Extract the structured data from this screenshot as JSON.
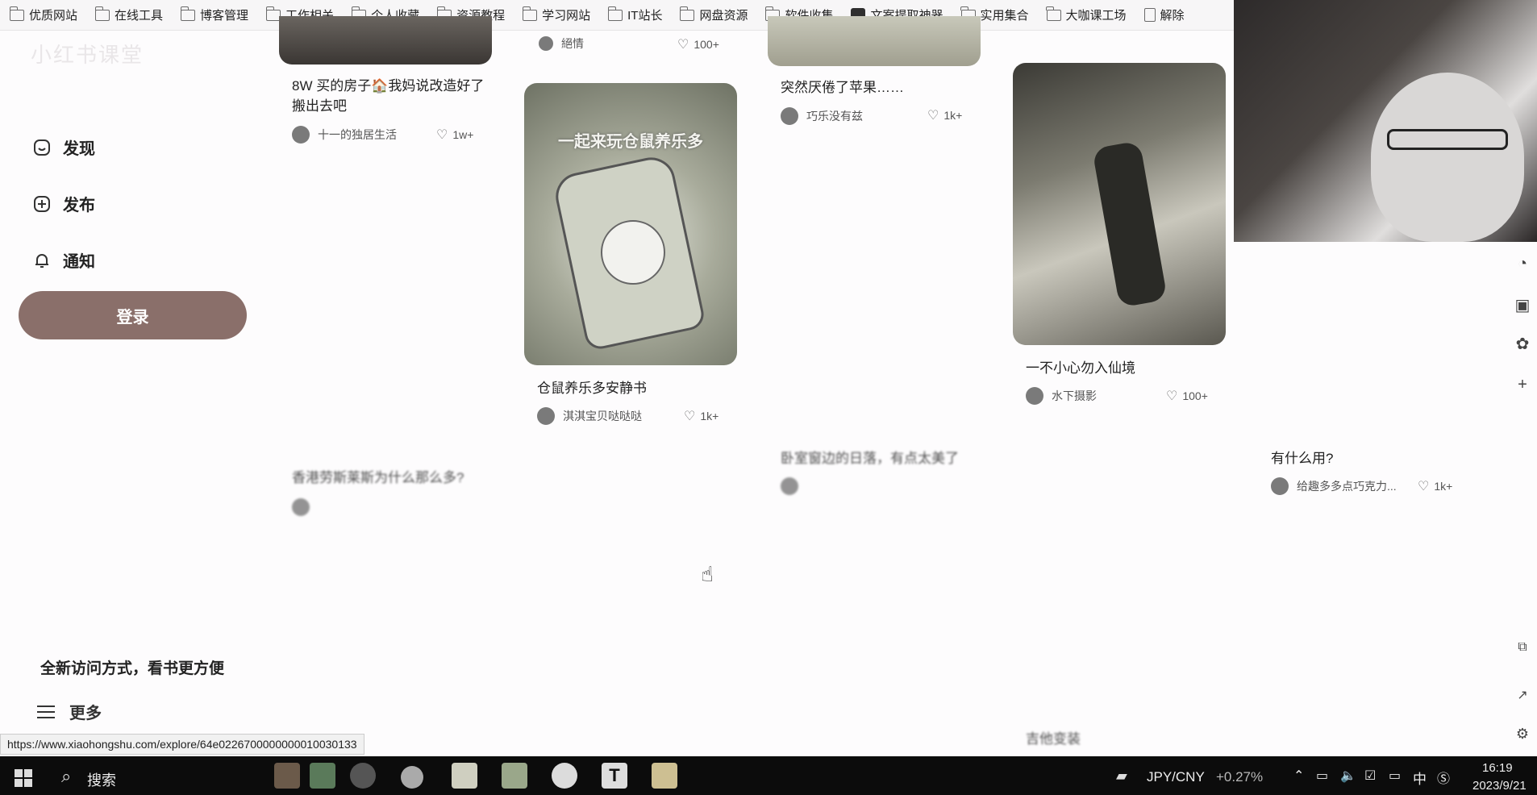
{
  "bookmarks": [
    {
      "label": "优质网站",
      "icon": "folder-icon"
    },
    {
      "label": "在线工具",
      "icon": "folder-icon"
    },
    {
      "label": "博客管理",
      "icon": "folder-icon"
    },
    {
      "label": "工作相关",
      "icon": "folder-icon"
    },
    {
      "label": "个人收藏",
      "icon": "folder-icon"
    },
    {
      "label": "资源教程",
      "icon": "folder-icon"
    },
    {
      "label": "学习网站",
      "icon": "folder-icon"
    },
    {
      "label": "IT站长",
      "icon": "folder-icon"
    },
    {
      "label": "网盘资源",
      "icon": "folder-icon"
    },
    {
      "label": "软件收集",
      "icon": "folder-icon"
    },
    {
      "label": "文案提取神器",
      "icon": "app-icon"
    },
    {
      "label": "实用集合",
      "icon": "folder-icon"
    },
    {
      "label": "大咖课工场",
      "icon": "folder-icon"
    },
    {
      "label": "解除",
      "icon": "doc-icon"
    }
  ],
  "sidebar": {
    "nav": [
      {
        "label": "发现",
        "icon": "home-icon"
      },
      {
        "label": "发布",
        "icon": "plus-circle-icon"
      },
      {
        "label": "通知",
        "icon": "bell-icon"
      }
    ],
    "login_label": "登录",
    "promo": "全新访问方式，看书更方便",
    "more_label": "更多"
  },
  "cards": [
    {
      "title": "8W 买的房子🏠我妈说改造好了搬出去吧",
      "author": "十一的独居生活",
      "likes": "1w+"
    },
    {
      "title": "",
      "author": "絕情",
      "likes": "100+"
    },
    {
      "title": "仓鼠养乐多安静书",
      "author": "淇淇宝贝哒哒哒",
      "likes": "1k+",
      "image_text": "一起来玩仓鼠养乐多"
    },
    {
      "title": "突然厌倦了苹果……",
      "author": "巧乐没有兹",
      "likes": "1k+"
    },
    {
      "title": "一不小心勿入仙境",
      "author": "水下摄影",
      "likes": "100+"
    },
    {
      "title": "香港劳斯莱斯为什么那么多?",
      "author": "",
      "likes": ""
    },
    {
      "title": "卧室窗边的日落，有点太美了",
      "author": "",
      "likes": ""
    },
    {
      "title": "有什么用?",
      "author": "给趣多多点巧克力...",
      "likes": "1k+"
    },
    {
      "title": "吉他变装",
      "author": "",
      "likes": ""
    }
  ],
  "status_url": "https://www.xiaohongshu.com/explore/64e0226700000000010030133",
  "taskbar": {
    "search_label": "搜索",
    "ticker": "JPY/CNY",
    "ticker_change": "+0.27%",
    "ime": "中",
    "time": "16:19",
    "date": "2023/9/21"
  }
}
